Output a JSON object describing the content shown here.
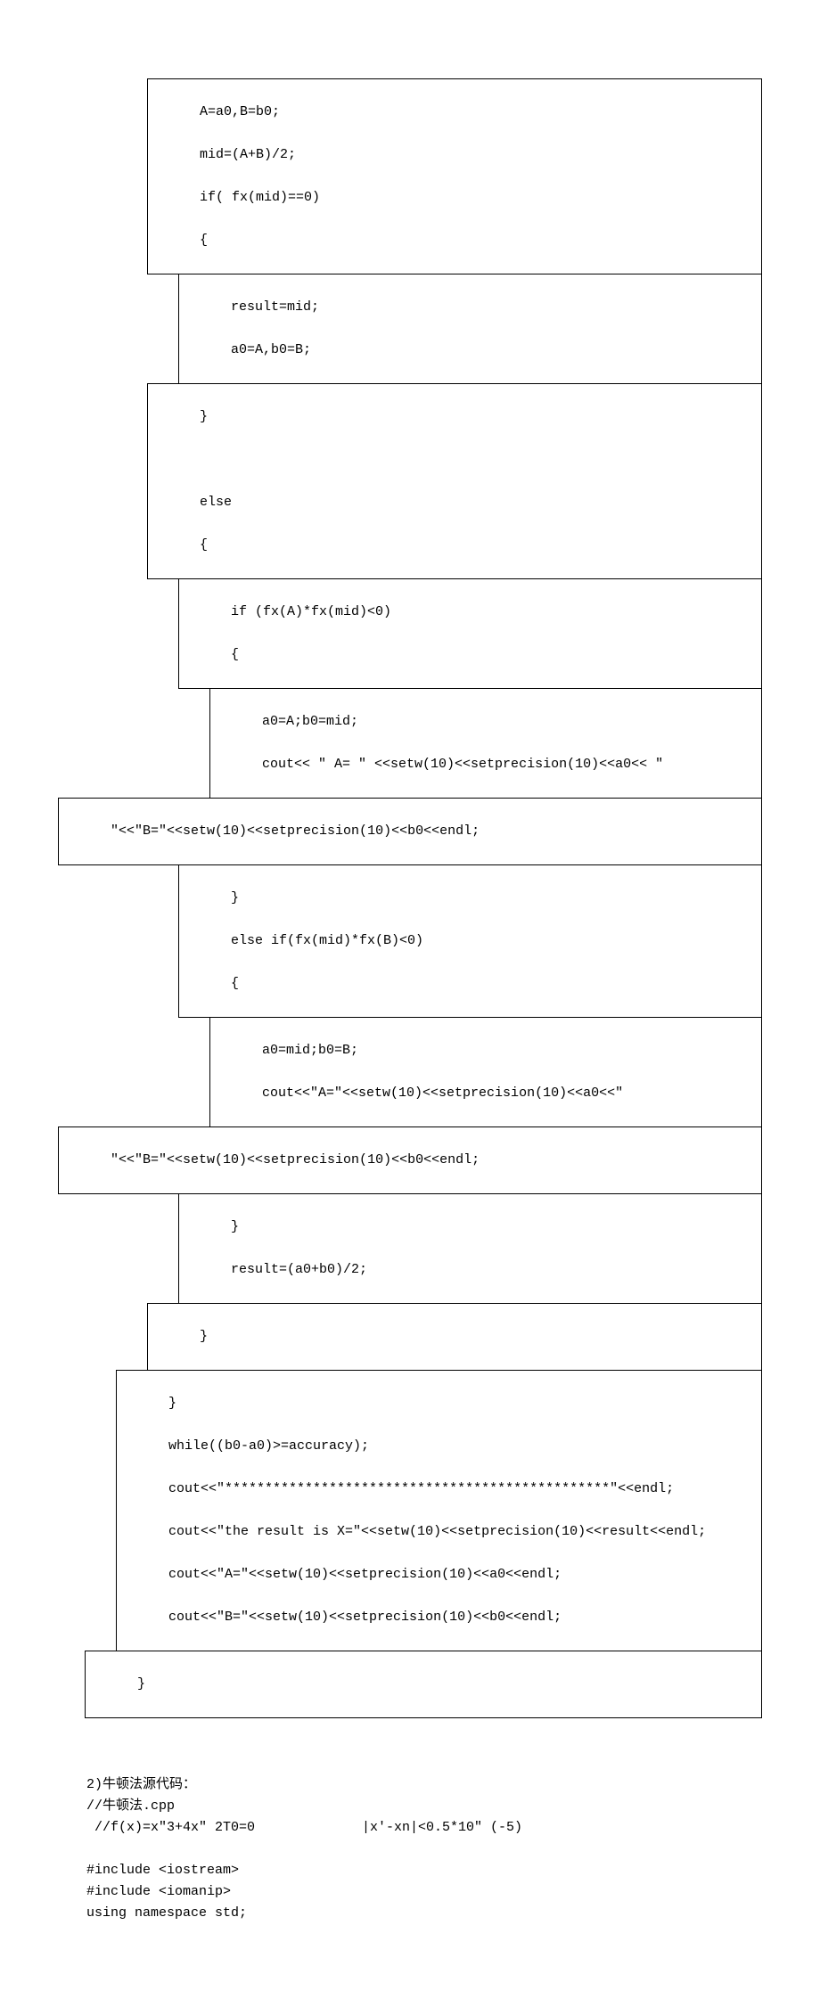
{
  "code": {
    "l1": "A=a0,B=b0;",
    "l2": "mid=(A+B)/2;",
    "l3": "if( fx(mid)==0)",
    "l4": "{",
    "l5": "result=mid;",
    "l6": "a0=A,b0=B;",
    "l7": "}",
    "l8": "else",
    "l9": "{",
    "l10": "if (fx(A)*fx(mid)<0)",
    "l11": "{",
    "l12": "a0=A;b0=mid;",
    "l13": "cout<< \" A= \" <<setw(10)<<setprecision(10)<<a0<< \"",
    "l14": "\"<<\"B=\"<<setw(10)<<setprecision(10)<<b0<<endl;",
    "l15": "}",
    "l16": "else if(fx(mid)*fx(B)<0)",
    "l17": "{",
    "l18": "a0=mid;b0=B;",
    "l19": "cout<<\"A=\"<<setw(10)<<setprecision(10)<<a0<<\"",
    "l20": "\"<<\"B=\"<<setw(10)<<setprecision(10)<<b0<<endl;",
    "l21": "}",
    "l22": "result=(a0+b0)/2;",
    "l23": "}",
    "l24": "}",
    "l25": "while((b0-a0)>=accuracy);",
    "l26": "cout<<\"************************************************\"<<endl;",
    "l27": "cout<<\"the result is X=\"<<setw(10)<<setprecision(10)<<result<<endl;",
    "l28": "cout<<\"A=\"<<setw(10)<<setprecision(10)<<a0<<endl;",
    "l29": "cout<<\"B=\"<<setw(10)<<setprecision(10)<<b0<<endl;",
    "l30": "}"
  },
  "newton": {
    "heading": "2)牛顿法源代码：",
    "c1": "//牛顿法.cpp",
    "c2a": " //f(x)=x\"3+4x\" 2T0=0",
    "c2b": "|x'-xn|<0.5*10\" (-5)",
    "c3": "#include <iostream>",
    "c4": "#include <iomanip>",
    "c5": "using namespace std;"
  }
}
